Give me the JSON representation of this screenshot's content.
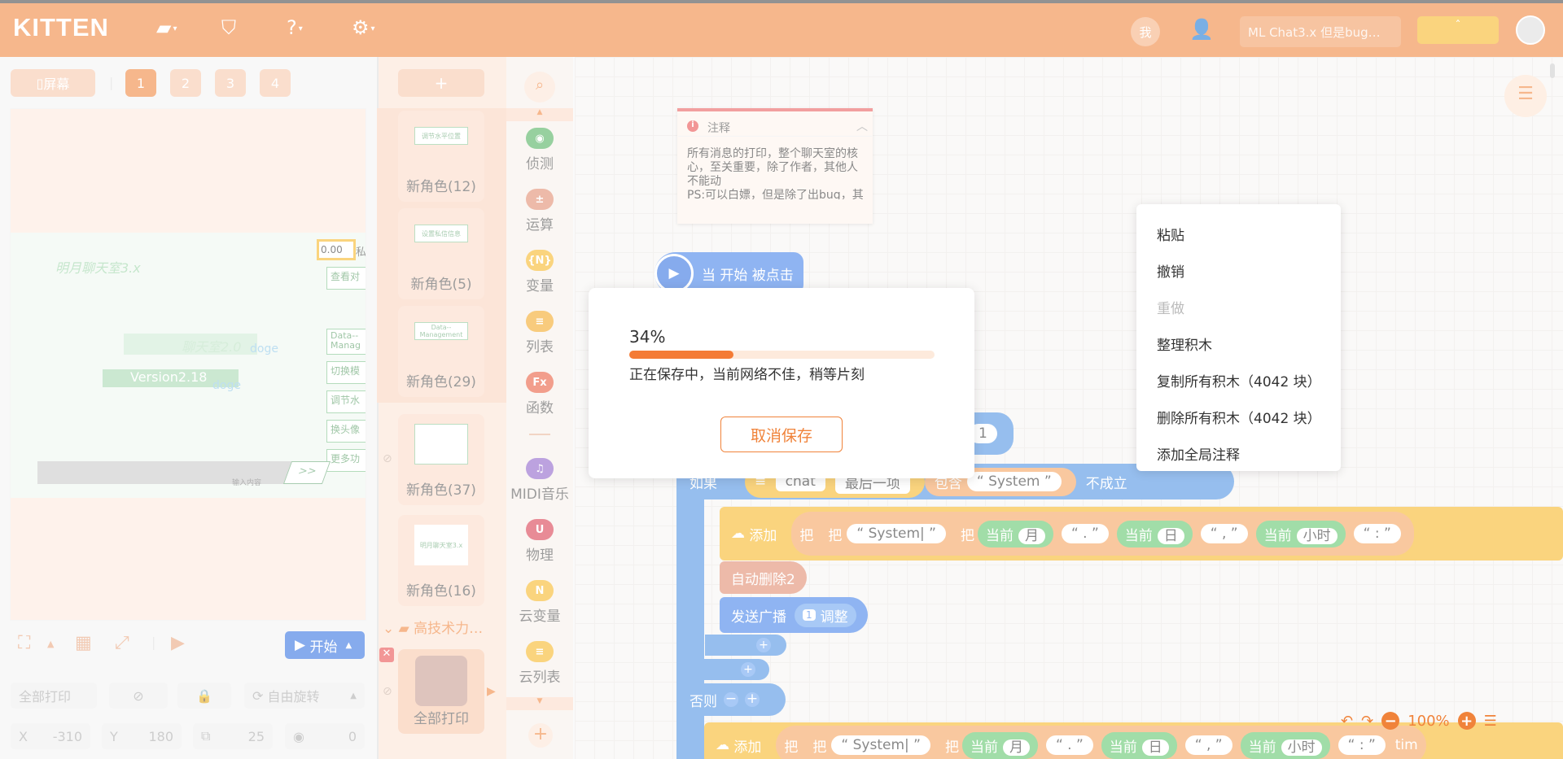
{
  "topbar": {
    "logo": "KITTEN",
    "me_label": "我",
    "project_name": "ML Chat3.x 但是bug…",
    "publish_label": "ˆ"
  },
  "stage": {
    "screen_label": "屏幕",
    "pages": [
      "1",
      "2",
      "3",
      "4"
    ],
    "title_text": "明月聊天室3.x",
    "sub_text": "聊天室2.0",
    "doge1": "doge",
    "version_text": "Version2.18",
    "doge2": "doge",
    "counter": "0.00",
    "side_btn_1": "私",
    "side_btn_2": "查看对",
    "side_btn_3": "Data--Manag",
    "side_btn_4": "切换模",
    "side_btn_5": "调节水",
    "side_btn_6": "换头像",
    "side_btn_7": "更多功",
    "input_placeholder": "输入内容",
    "send_label": ">>",
    "start_label": "开始",
    "sprite_name": "全部打印",
    "rotate_label": "自由旋转",
    "x_label": "X",
    "x_value": "-310",
    "y_label": "Y",
    "y_value": "180",
    "size_value": "25",
    "dir_value": "0"
  },
  "sprites": {
    "add_label": "+",
    "items": [
      {
        "name": "新角色(12)",
        "thumb": "调节水平位置"
      },
      {
        "name": "新角色(5)",
        "thumb": "设置私信信息"
      },
      {
        "name": "新角色(29)",
        "thumb": "Data--Management"
      },
      {
        "name": "新角色(37)",
        "thumb": ""
      },
      {
        "name": "新角色(16)",
        "thumb": "明月聊天室3.x"
      }
    ],
    "folder_label": "高技术力…",
    "current": "全部打印"
  },
  "categories": [
    {
      "label": "侦测",
      "color": "#4cae5a",
      "glyph": "◉"
    },
    {
      "label": "运算",
      "color": "#e0896b",
      "glyph": "±"
    },
    {
      "label": "变量",
      "color": "#f6b622",
      "glyph": "{N}"
    },
    {
      "label": "列表",
      "color": "#f3a520",
      "glyph": "≡"
    },
    {
      "label": "函数",
      "color": "#e8593a",
      "glyph": "Fx"
    },
    {
      "label": "MIDI音乐",
      "color": "#8c5fc8",
      "glyph": "♫"
    },
    {
      "label": "物理",
      "color": "#d8384a",
      "glyph": "U"
    },
    {
      "label": "云变量",
      "color": "#f6b622",
      "glyph": "N"
    },
    {
      "label": "云列表",
      "color": "#f6b622",
      "glyph": "≡"
    }
  ],
  "comment": {
    "title": "注释",
    "body": "所有消息的打印，整个聊天室的核心，至关重要，除了作者，其他人不能动\nPS:可以白嫖，但是除了出bug，其他情况下不能动"
  },
  "blocks": {
    "hat": "当 开始 被点击",
    "if_label": "如果",
    "chat_var": "chat",
    "last_item": "最后一项",
    "contains": "包含",
    "system_str": "“ System ”",
    "not_true": "不成立",
    "add_label": "添加",
    "ba": "把",
    "system_bar": "“ System| ”",
    "current": "当前",
    "month": "月",
    "day": "日",
    "hour": "小时",
    "dot_str": "“ . ”",
    "comma_str": "“ , ”",
    "colon_str": "“ : ”",
    "auto_delete": "自动删除2",
    "broadcast": "发送广播",
    "adjust": "调整",
    "adjust_num": "1",
    "else_label": "否则",
    "num_one": "1",
    "tim": "tim"
  },
  "context_menu": {
    "items": [
      {
        "label": "粘贴",
        "disabled": false
      },
      {
        "label": "撤销",
        "disabled": false
      },
      {
        "label": "重做",
        "disabled": true
      },
      {
        "label": "整理积木",
        "disabled": false
      },
      {
        "label": "复制所有积木（4042 块）",
        "disabled": false
      },
      {
        "label": "删除所有积木（4042 块）",
        "disabled": false
      },
      {
        "label": "添加全局注释",
        "disabled": false
      }
    ]
  },
  "modal": {
    "percent_text": "34%",
    "progress": 0.34,
    "message": "正在保存中，当前网络不佳，稍等片刻",
    "cancel_label": "取消保存"
  },
  "zoom": {
    "level": "100%"
  }
}
